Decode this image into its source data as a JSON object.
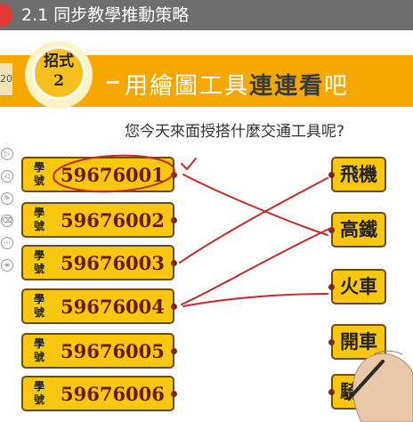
{
  "video": {
    "title": "2.1 同步教學推動策略"
  },
  "badge": {
    "left_label": "20"
  },
  "banner": {
    "bulb_line1": "招式",
    "bulb_line2": "2",
    "heading_plain": "用繪圖工具",
    "heading_strong": "連連看",
    "heading_tail": "吧"
  },
  "question": "您今天來面授搭什麼交通工具呢?",
  "students": [
    {
      "label": "學號",
      "number": "59676001"
    },
    {
      "label": "學號",
      "number": "59676002"
    },
    {
      "label": "學號",
      "number": "59676003"
    },
    {
      "label": "學號",
      "number": "59676004"
    },
    {
      "label": "學號",
      "number": "59676005"
    },
    {
      "label": "學號",
      "number": "59676006"
    }
  ],
  "vehicles": [
    "飛機",
    "高鐵",
    "火車",
    "開車",
    "騎車"
  ],
  "side_tools": [
    "play-icon",
    "back-icon",
    "pen-icon",
    "eraser-icon",
    "more-icon",
    "menu-icon"
  ],
  "colors": {
    "banner": "#f7a800",
    "card": "#f9c80e",
    "ink": "#c62828"
  }
}
